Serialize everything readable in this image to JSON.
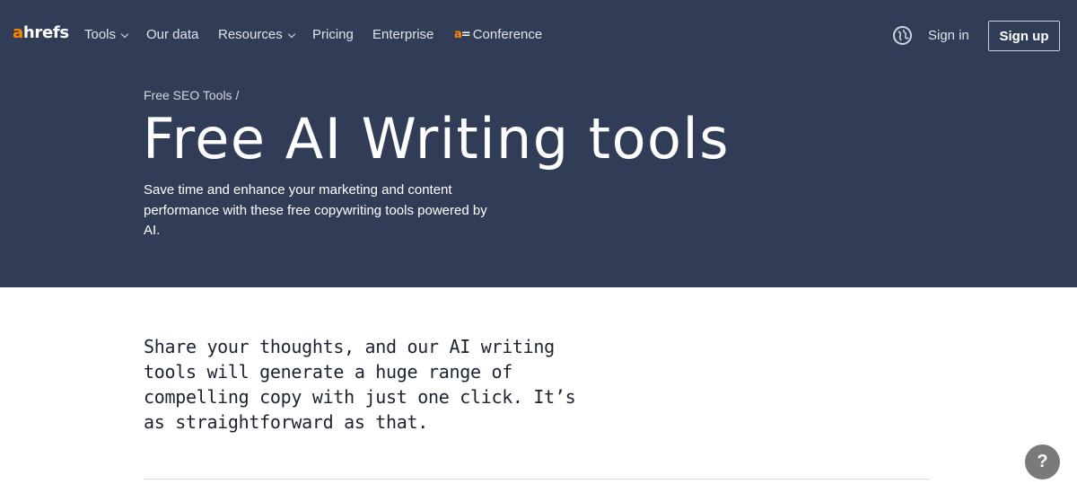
{
  "header": {
    "logo": {
      "a": "a",
      "rest": "hrefs"
    },
    "nav": [
      {
        "label": "Tools",
        "dropdown": true
      },
      {
        "label": "Our data",
        "dropdown": false
      },
      {
        "label": "Resources",
        "dropdown": true
      },
      {
        "label": "Pricing",
        "dropdown": false
      },
      {
        "label": "Enterprise",
        "dropdown": false
      },
      {
        "label": "Conference",
        "dropdown": false,
        "icon": "ahrefs-evolve-icon"
      }
    ],
    "language_icon": "globe-icon",
    "sign_in": "Sign in",
    "sign_up": "Sign up"
  },
  "hero": {
    "breadcrumb": "Free SEO Tools /",
    "title": "Free AI Writing tools",
    "subtitle": "Save time and enhance your marketing and content performance with these free copywriting tools powered by AI."
  },
  "main": {
    "lead": "Share your thoughts, and our AI writing tools will generate a huge range of compelling copy with just one click. It’s as straightforward as that."
  },
  "help_button": {
    "label": "?",
    "icon": "question-icon"
  },
  "colors": {
    "hero_bg": "#313d56",
    "brand_orange": "#ff8800",
    "text_dark": "#1c2330",
    "help_bg": "#7a7a7a"
  }
}
